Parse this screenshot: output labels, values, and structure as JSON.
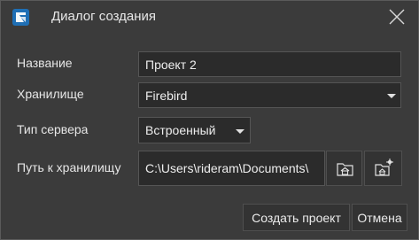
{
  "window": {
    "title": "Диалог создания",
    "app_icon": "app-logo-icon",
    "close_icon": "close-icon"
  },
  "form": {
    "name_label": "Название",
    "name_value": "Проект 2",
    "storage_label": "Хранилище",
    "storage_value": "Firebird",
    "server_type_label": "Тип сервера",
    "server_type_value": "Встроенный",
    "path_label": "Путь к хранилищу",
    "path_value": "C:\\Users\\rideram\\Documents\\",
    "browse_icon": "folder-home-icon",
    "new_folder_icon": "folder-add-icon"
  },
  "buttons": {
    "create_label": "Создать проект",
    "cancel_label": "Отмена"
  },
  "colors": {
    "background": "#3b3b3b",
    "field_background": "#2b2b2b",
    "accent": "#1f6fb5"
  }
}
